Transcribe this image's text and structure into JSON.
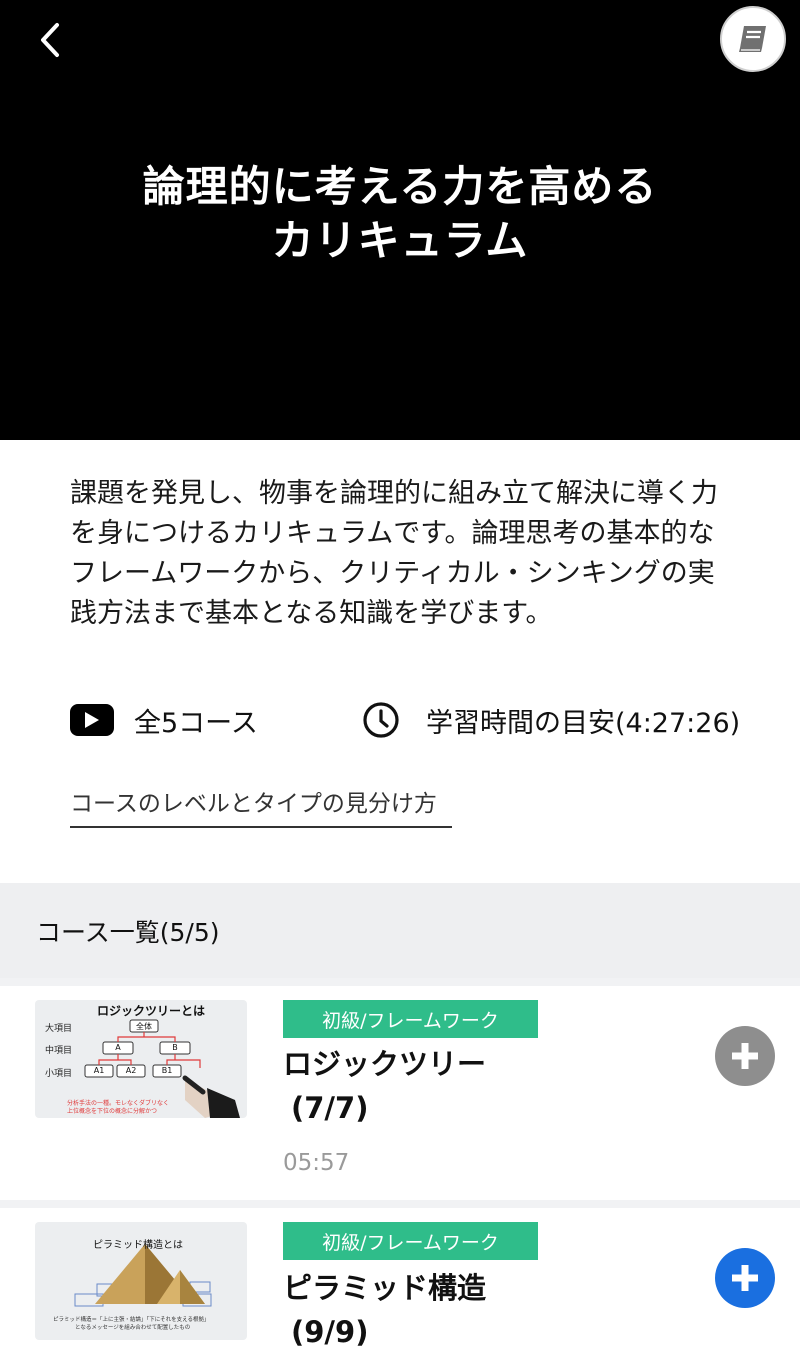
{
  "hero": {
    "title_line1": "論理的に考える力を高める",
    "title_line2": "カリキュラム",
    "back_icon": "chevron-left-icon",
    "book_icon": "book-icon"
  },
  "description": "課題を発見し、物事を論理的に組み立て解決に導く力を身につけるカリキュラムです。論理思考の基本的なフレームワークから、クリティカル・シンキングの実践方法まで基本となる知識を学びます。",
  "meta": {
    "course_count": "全5コース",
    "study_time": "学習時間の目安(4:27:26)"
  },
  "level_link": "コースのレベルとタイプの見分け方",
  "course_list": {
    "header": "コース一覧(5/5)",
    "items": [
      {
        "tag": "初級/フレームワーク",
        "title_line1": "ロジックツリー",
        "title_line2": "(7/7)",
        "duration": "05:57",
        "thumb": {
          "heading": "ロジックツリーとは",
          "row_labels": [
            "大項目",
            "中項目",
            "小項目"
          ],
          "box_top": "全体",
          "box_mid": [
            "A",
            "B"
          ],
          "box_low": [
            "A1",
            "A2",
            "B1"
          ],
          "caption_line1": "分析手法の一種。モレなくダブリなく",
          "caption_line2": "上位概念を下位の概念に分解かつ"
        },
        "add_state": "added",
        "add_color": "#8e8e8e"
      },
      {
        "tag": "初級/フレームワーク",
        "title_line1": "ピラミッド構造",
        "title_line2": "(9/9)",
        "thumb": {
          "heading": "ピラミッド構造とは",
          "caption_line1": "ピラミッド構造＝「上に主張・結論」「下にそれを支える根拠」",
          "caption_line2": "となるメッセージを組み合わせて配置したもの"
        },
        "add_state": "not-added",
        "add_color": "#1a6fe0"
      }
    ]
  }
}
